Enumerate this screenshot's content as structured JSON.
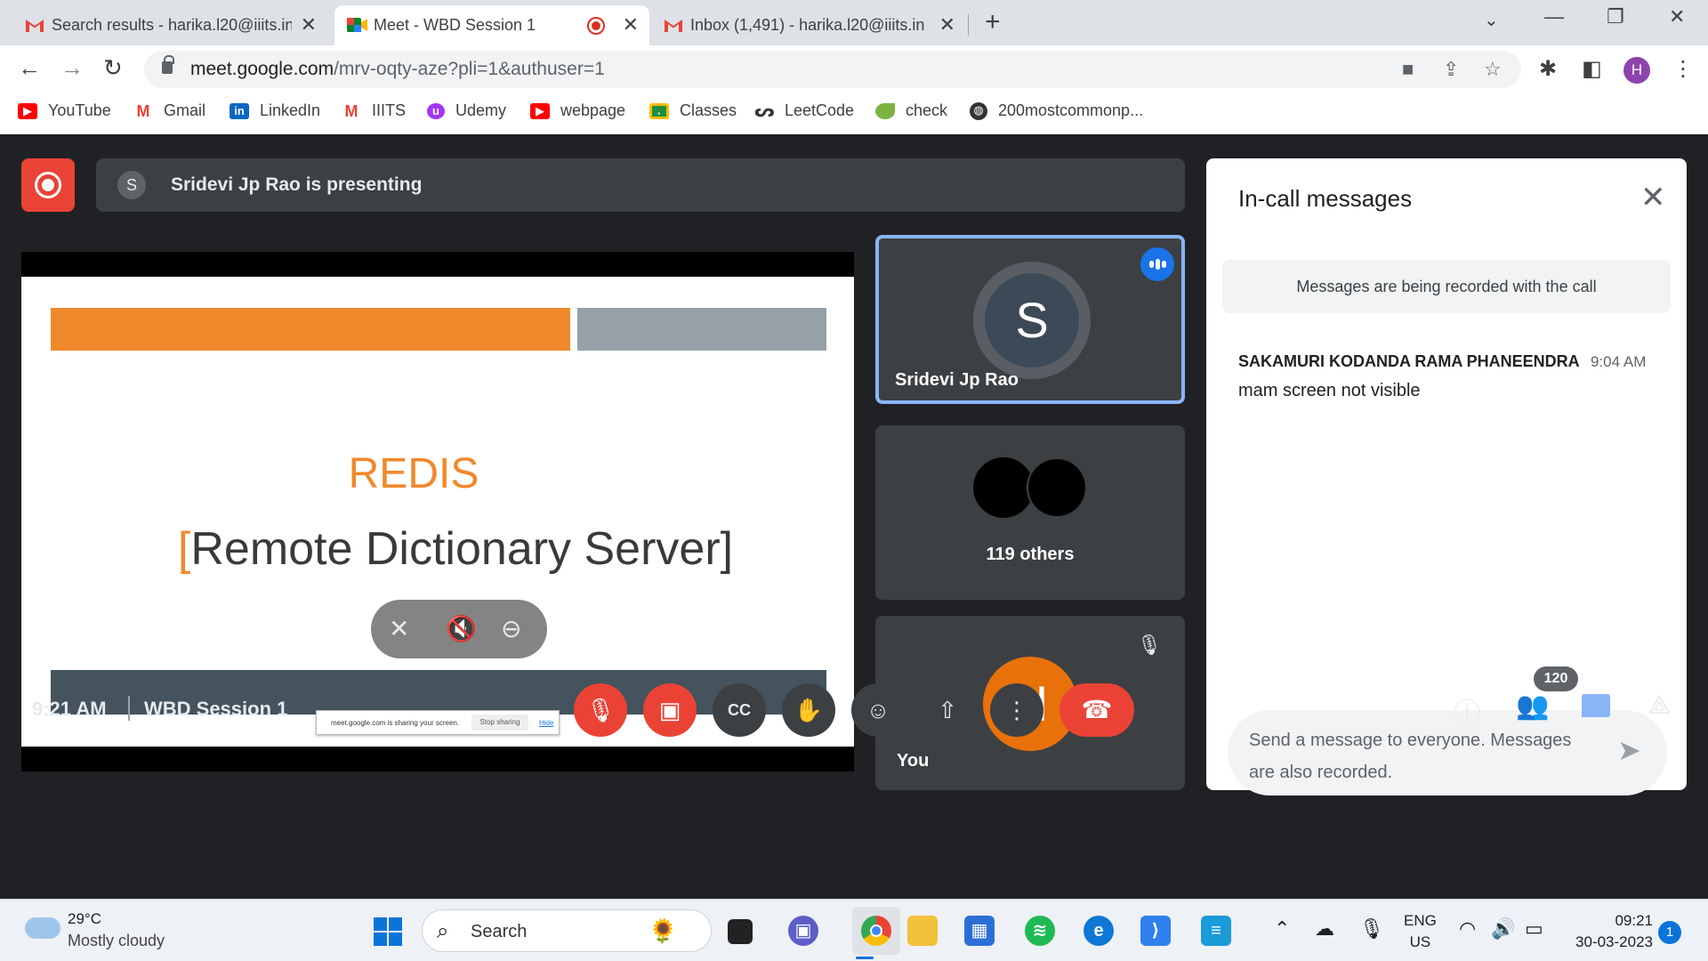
{
  "browser": {
    "tabs": [
      {
        "title": "Search results - harika.l20@iiits.in",
        "icon": "gmail-icon"
      },
      {
        "title": "Meet - WBD Session 1",
        "icon": "meet-icon",
        "active": true,
        "recording": true
      },
      {
        "title": "Inbox (1,491) - harika.l20@iiits.in",
        "icon": "gmail-icon"
      }
    ],
    "url_host": "meet.google.com",
    "url_path": "/mrv-oqty-aze?pli=1&authuser=1",
    "profile_initial": "H",
    "bookmarks": [
      {
        "label": "YouTube",
        "icon": "youtube-icon",
        "color": "#ff0000"
      },
      {
        "label": "Gmail",
        "icon": "gmail-icon",
        "color": "#ea4335"
      },
      {
        "label": "LinkedIn",
        "icon": "linkedin-icon",
        "color": "#0a66c2"
      },
      {
        "label": "IIITS",
        "icon": "gmail-icon",
        "color": "#ea4335"
      },
      {
        "label": "Udemy",
        "icon": "udemy-icon",
        "color": "#a435f0"
      },
      {
        "label": "webpage",
        "icon": "youtube-icon",
        "color": "#ff0000"
      },
      {
        "label": "Classes",
        "icon": "classroom-icon",
        "color": "#1e8e3e"
      },
      {
        "label": "LeetCode",
        "icon": "leetcode-icon",
        "color": "#333333"
      },
      {
        "label": "check",
        "icon": "leaf-icon",
        "color": "#7cb342"
      },
      {
        "label": "200mostcommonp...",
        "icon": "globe-icon",
        "color": "#333333"
      }
    ]
  },
  "meet": {
    "presenting_initial": "S",
    "presenting_text": "Sridevi Jp Rao is presenting",
    "slide": {
      "title": "REDIS",
      "subtitle_open": "[",
      "subtitle": "Remote Dictionary Server",
      "subtitle_close": "]",
      "share_notice": "meet.google.com is sharing your screen.",
      "stop_sharing": "Stop sharing",
      "hide": "Hide"
    },
    "tiles": {
      "speaker_initial": "S",
      "speaker_name": "Sridevi Jp Rao",
      "others": "119 others",
      "you_initial": "H",
      "you_label": "You"
    },
    "chat": {
      "title": "In-call messages",
      "notice": "Messages are being recorded with the call",
      "messages": [
        {
          "sender": "SAKAMURI KODANDA RAMA PHANEENDRA",
          "time": "9:04 AM",
          "text": "mam screen not visible"
        }
      ],
      "placeholder": "Send a message to everyone. Messages are also recorded."
    },
    "bottom": {
      "time": "9:21 AM",
      "meeting_name": "WBD Session 1",
      "participant_count": "120"
    }
  },
  "taskbar": {
    "temperature": "29°C",
    "condition": "Mostly cloudy",
    "search_label": "Search",
    "lang_top": "ENG",
    "lang_bottom": "US",
    "time": "09:21",
    "date": "30-03-2023",
    "notifications": "1"
  }
}
